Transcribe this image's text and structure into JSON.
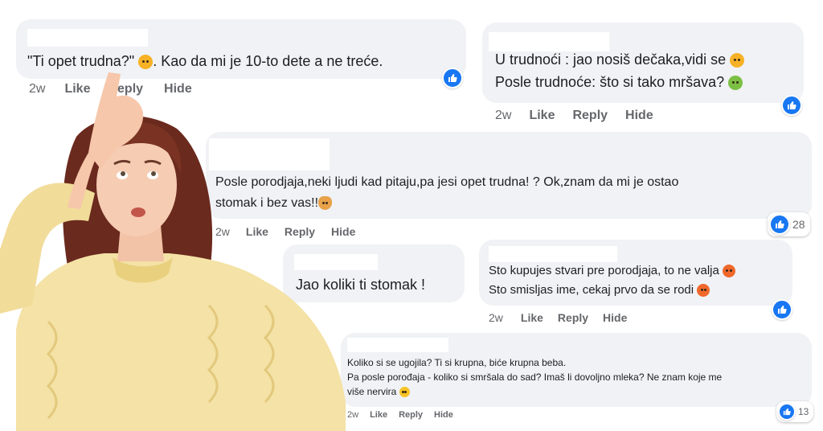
{
  "comments": [
    {
      "id": "c1",
      "text": "\"Ti opet trudna?\"",
      "text_after_emoji": ". Kao da mi je 10-to dete a ne treće.",
      "emoji": "sad-face",
      "time": "2w",
      "like": "Like",
      "reply": "Reply",
      "hide": "Hide"
    },
    {
      "id": "c2",
      "line1": "U trudnoći : jao nosiš dečaka,vidi se",
      "line1_emoji": "laughing-face",
      "line2": "Posle trudnoće: što si tako mršava?",
      "line2_emoji": "sick-face",
      "time": "2w",
      "like": "Like",
      "reply": "Reply",
      "hide": "Hide"
    },
    {
      "id": "c3",
      "line1": "Posle porodjaja,neki ljudi kad pitaju,pa jesi opet trudna! ? Ok,znam da mi je ostao",
      "line2": "stomak i bez vas!!",
      "line2_emoji": "facepalm",
      "reactions": "28",
      "time": "2w",
      "like": "Like",
      "reply": "Reply",
      "hide": "Hide"
    },
    {
      "id": "c4",
      "text": "Jao koliki ti stomak !"
    },
    {
      "id": "c5",
      "line1": "Sto kupujes stvari pre porodjaja, to ne valja",
      "line1_emoji": "angry-face",
      "line2": "Sto smisljas ime, cekaj prvo da se rodi",
      "line2_emoji": "angry-face",
      "time": "2w",
      "like": "Like",
      "reply": "Reply",
      "hide": "Hide"
    },
    {
      "id": "c6",
      "line1": "Koliko si se ugojila? Ti si krupna, biće krupna beba.",
      "line2": "Pa posle porođaja - koliko si smršala do sad? Imaš li dovoljno mleka? Ne znam koje me",
      "line3": "više nervira",
      "line3_emoji": "grinning-face",
      "reactions": "13",
      "time": "2w",
      "like": "Like",
      "reply": "Reply",
      "hide": "Hide"
    }
  ],
  "colors": {
    "bubble": "#f0f2f5",
    "like_blue": "#1877f2",
    "meta_gray": "#65676b",
    "sweater": "#f4e2a6",
    "hair": "#6b2a1e"
  }
}
